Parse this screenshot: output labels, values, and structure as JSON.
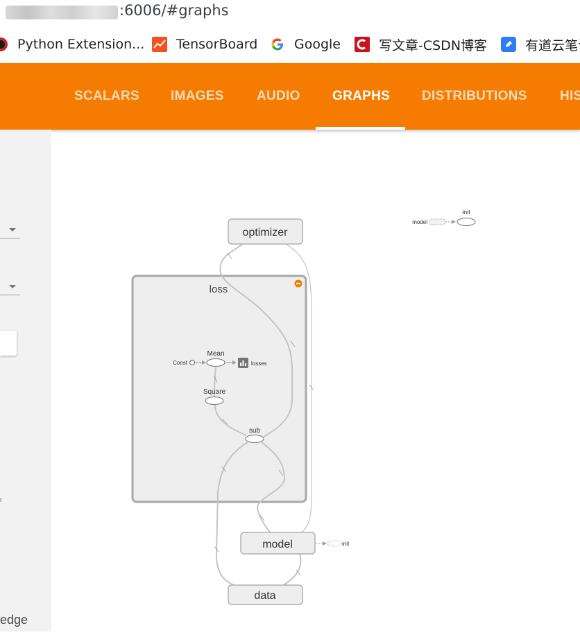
{
  "browser": {
    "url_suffix": ":6006/#graphs",
    "bookmarks": [
      {
        "label": "Python Extension..."
      },
      {
        "label": "TensorBoard"
      },
      {
        "label": "Google"
      },
      {
        "label": "写文章-CSDN博客"
      },
      {
        "label": "有道云笔记"
      }
    ]
  },
  "tabs": [
    {
      "label": "SCALARS"
    },
    {
      "label": "IMAGES"
    },
    {
      "label": "AUDIO"
    },
    {
      "label": "GRAPHS"
    },
    {
      "label": "DISTRIBUTIONS"
    },
    {
      "label": "HISTOGRAMS"
    }
  ],
  "active_tab": "GRAPHS",
  "sidebar": {
    "bottom_label": "edge",
    "fragment_text": "r"
  },
  "graph": {
    "nodes": {
      "optimizer": "optimizer",
      "loss": "loss",
      "model": "model",
      "data": "data",
      "mean": "Mean",
      "const": "Const",
      "losses": "losses",
      "square": "Square",
      "sub": "sub",
      "init_main": "init",
      "model_aux": "model",
      "init_aux": "init"
    }
  },
  "colors": {
    "accent": "#f57c00",
    "node_fill": "#eeeeee",
    "node_stroke": "#b0b0b0",
    "edge": "#bdbdbd"
  }
}
